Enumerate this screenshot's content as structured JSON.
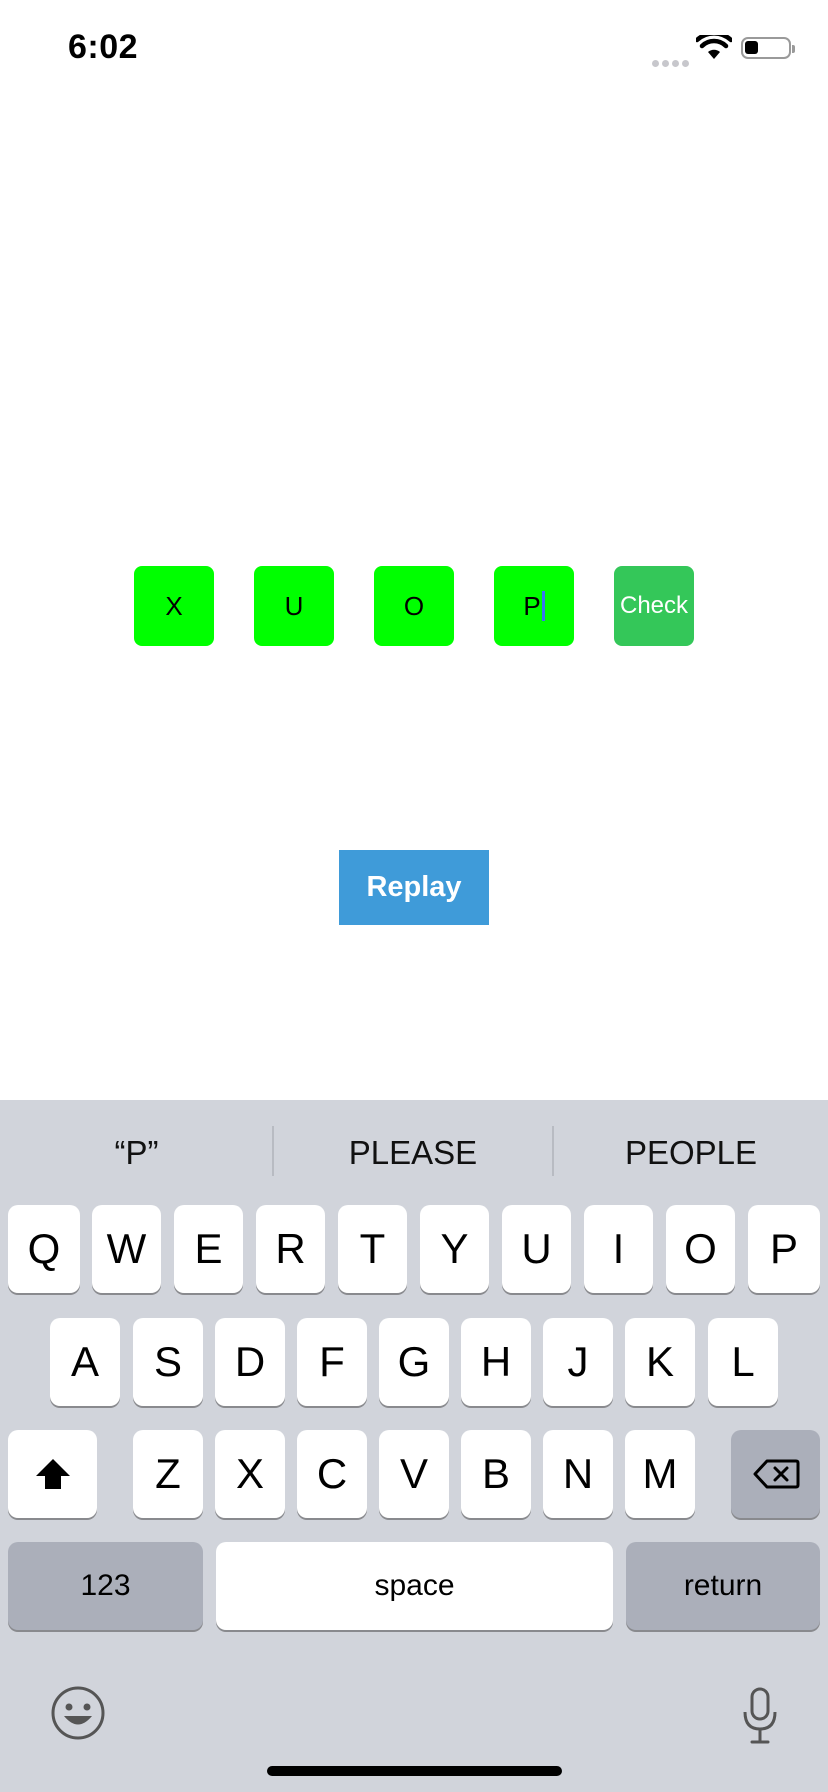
{
  "status_bar": {
    "time": "6:02",
    "icons": [
      "signal-dots-icon",
      "wifi-icon",
      "battery-icon"
    ]
  },
  "game": {
    "letters": [
      "X",
      "U",
      "O",
      "P"
    ],
    "check_label": "Check",
    "replay_label": "Replay",
    "colors": {
      "tile": "#00ff00",
      "check": "#34c759",
      "replay": "#3f9bd9"
    }
  },
  "keyboard": {
    "suggestions": [
      "“P”",
      "PLEASE",
      "PEOPLE"
    ],
    "row1": [
      "Q",
      "W",
      "E",
      "R",
      "T",
      "Y",
      "U",
      "I",
      "O",
      "P"
    ],
    "row2": [
      "A",
      "S",
      "D",
      "F",
      "G",
      "H",
      "J",
      "K",
      "L"
    ],
    "row3": [
      "Z",
      "X",
      "C",
      "V",
      "B",
      "N",
      "M"
    ],
    "numbers_label": "123",
    "space_label": "space",
    "return_label": "return"
  }
}
